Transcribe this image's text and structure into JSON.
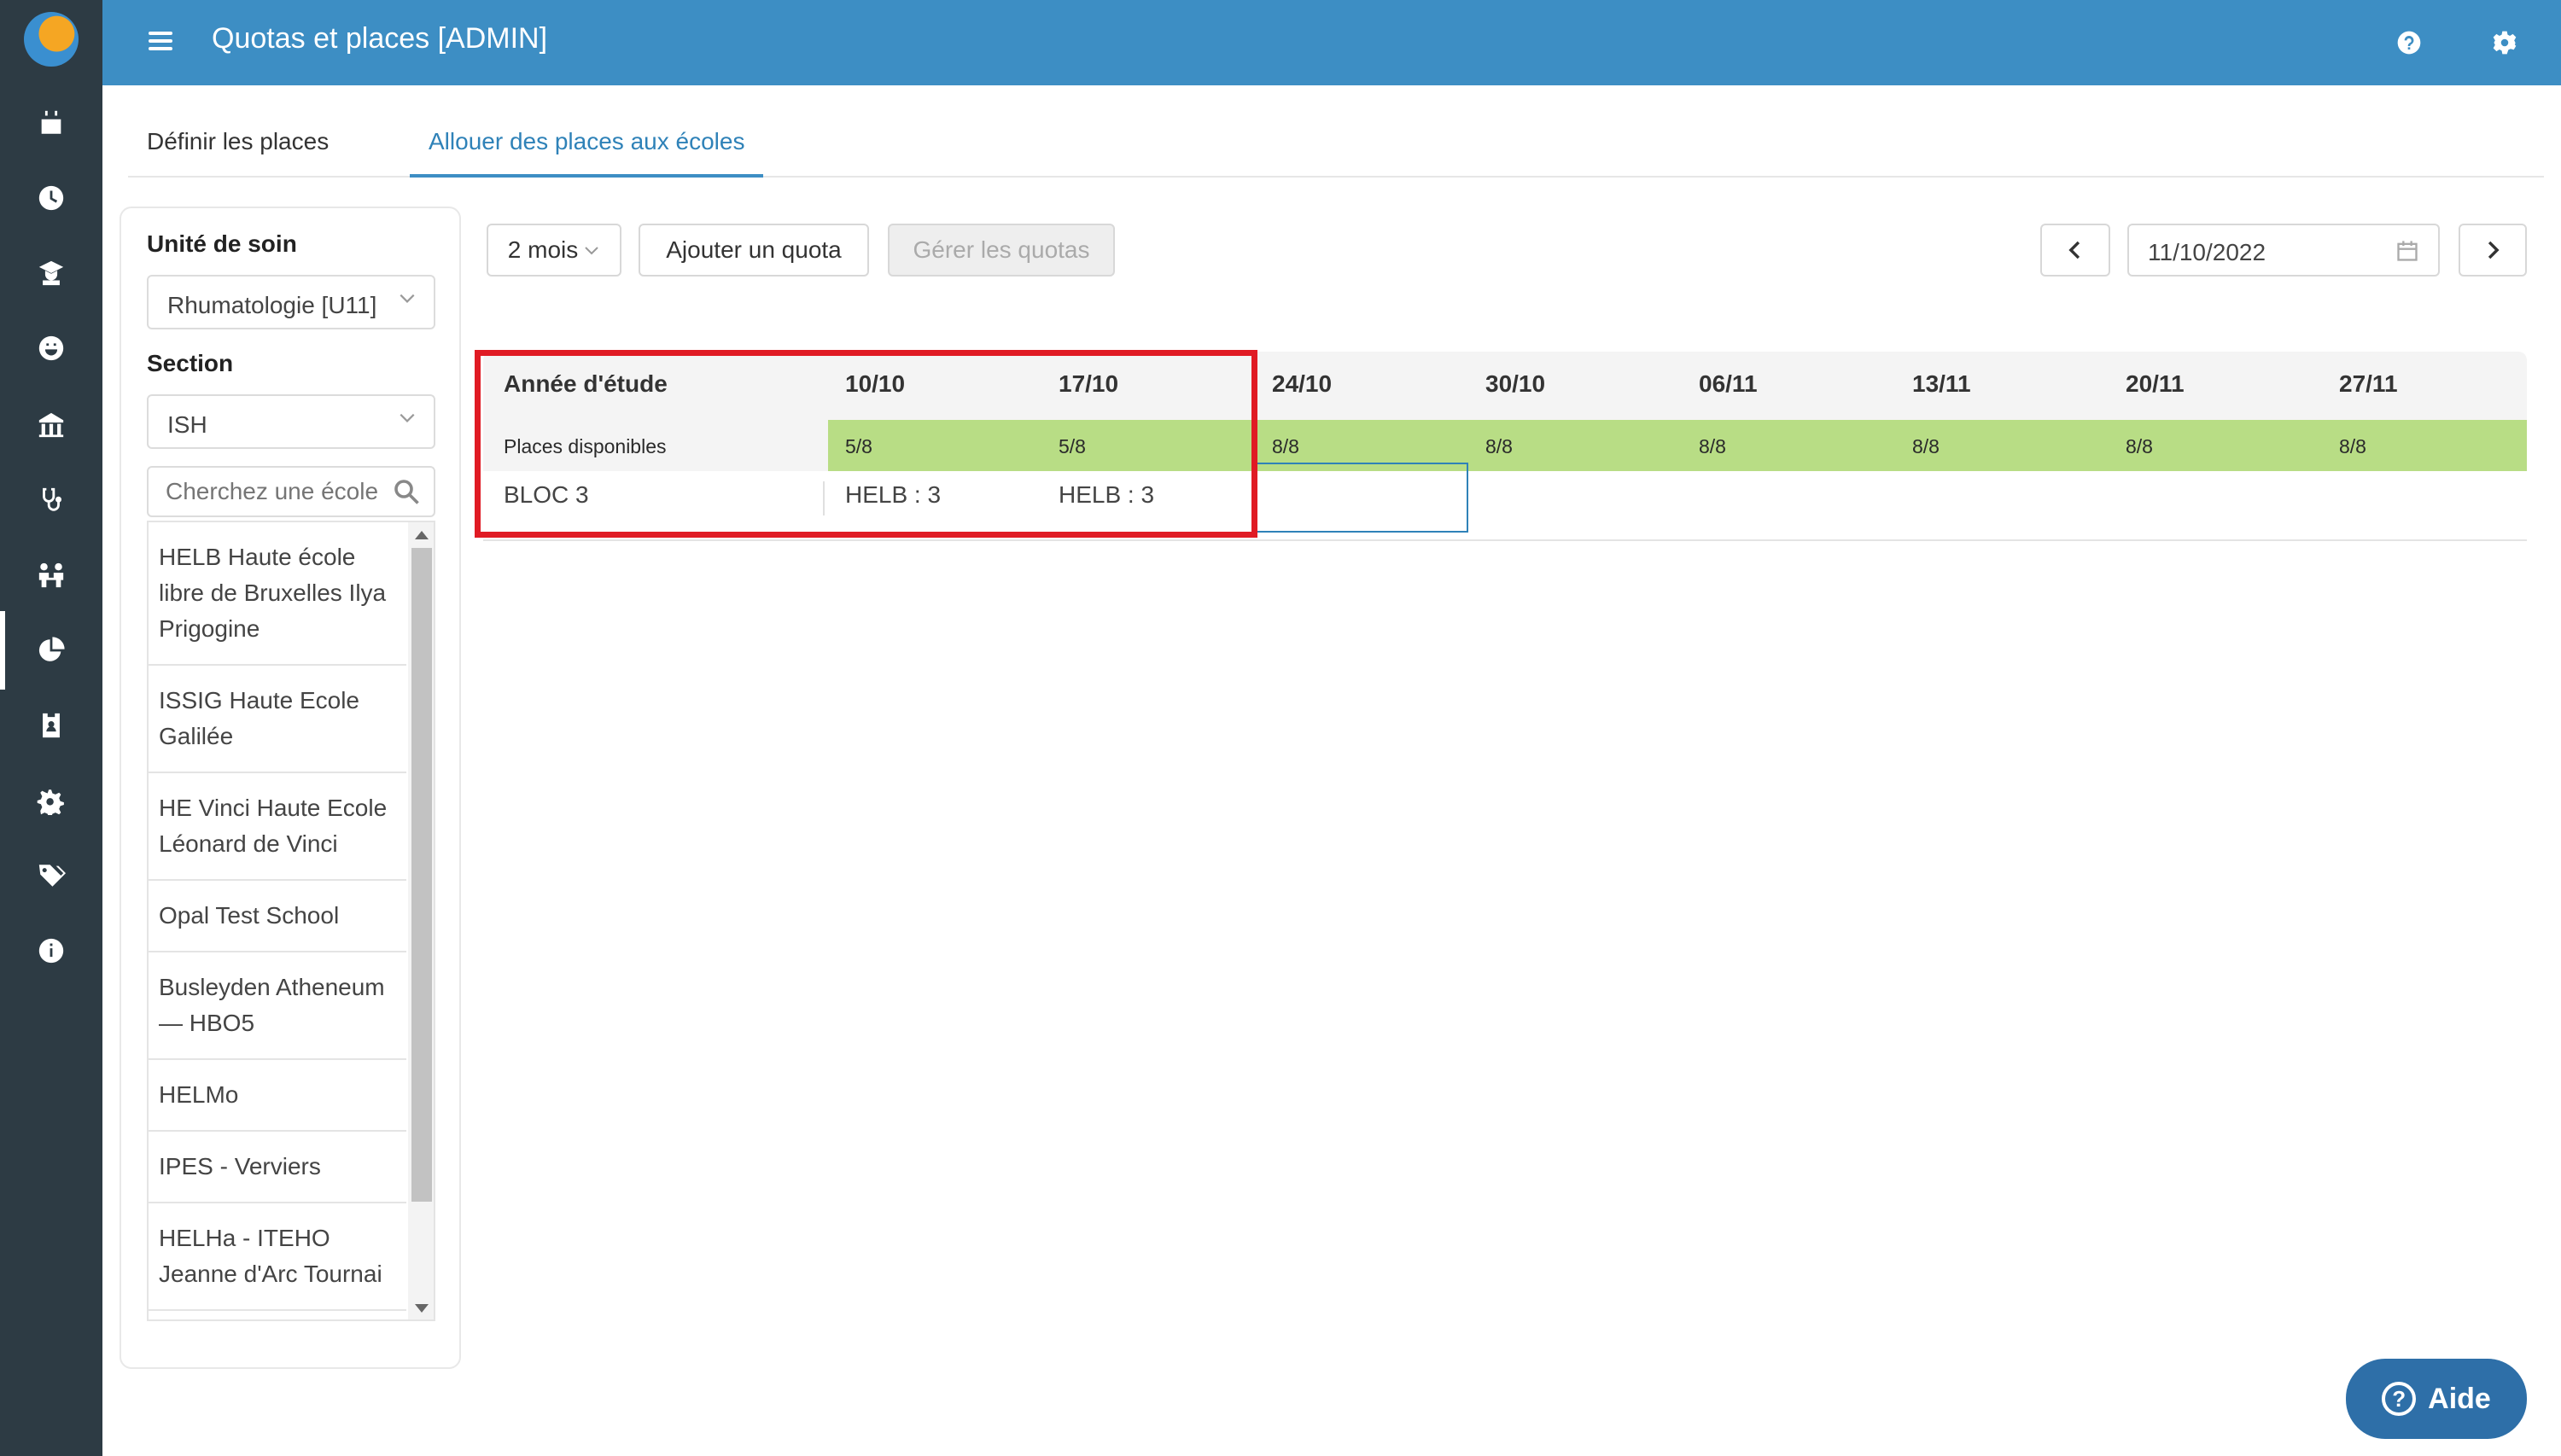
{
  "header": {
    "title": "Quotas et places [ADMIN]",
    "help_icon": "question-circle-icon",
    "settings_icon": "gear-icon"
  },
  "rail": {
    "icons": [
      "calendar-icon",
      "clock-icon",
      "student-icon",
      "smiley-icon",
      "school-icon",
      "stethoscope-icon",
      "people-icon",
      "pie-chart-icon",
      "badge-icon",
      "gears-icon",
      "tags-icon",
      "info-icon"
    ],
    "active": "pie-chart-icon"
  },
  "tabs": [
    {
      "label": "Définir les places",
      "active": false
    },
    {
      "label": "Allouer des places aux écoles",
      "active": true
    }
  ],
  "filters": {
    "unit_label": "Unité de soin",
    "unit_value": "Rhumatologie [U11]",
    "section_label": "Section",
    "section_value": "ISH",
    "search_placeholder": "Cherchez une école",
    "schools": [
      "HELB Haute école libre de Bruxelles Ilya Prigogine",
      "ISSIG Haute Ecole Galilée",
      "HE Vinci Haute Ecole Léonard de Vinci",
      "Opal Test School",
      "Busleyden Atheneum — HBO5",
      "HELMo",
      "IPES - Verviers",
      "HELHa - ITEHO Jeanne d'Arc Tournai"
    ]
  },
  "toolbar": {
    "period": "2 mois",
    "add_quota": "Ajouter un quota",
    "manage_quotas": "Gérer les quotas",
    "date": "11/10/2022"
  },
  "grid": {
    "header_label": "Année d'étude",
    "available_label": "Places disponibles",
    "weeks": [
      "10/10",
      "17/10",
      "24/10",
      "30/10",
      "06/11",
      "13/11",
      "20/11",
      "27/11"
    ],
    "available": [
      "5/8",
      "5/8",
      "8/8",
      "8/8",
      "8/8",
      "8/8",
      "8/8",
      "8/8"
    ],
    "row_label": "BLOC 3",
    "row_values": [
      "HELB : 3",
      "HELB : 3",
      "",
      "",
      "",
      "",
      "",
      ""
    ]
  },
  "help_button": {
    "label": "Aide"
  },
  "colors": {
    "topbar": "#3d8ec4",
    "rail": "#2d3b44",
    "available_green": "#b8dd85",
    "highlight_red": "#e01b24",
    "help_button": "#2e6fa8"
  }
}
